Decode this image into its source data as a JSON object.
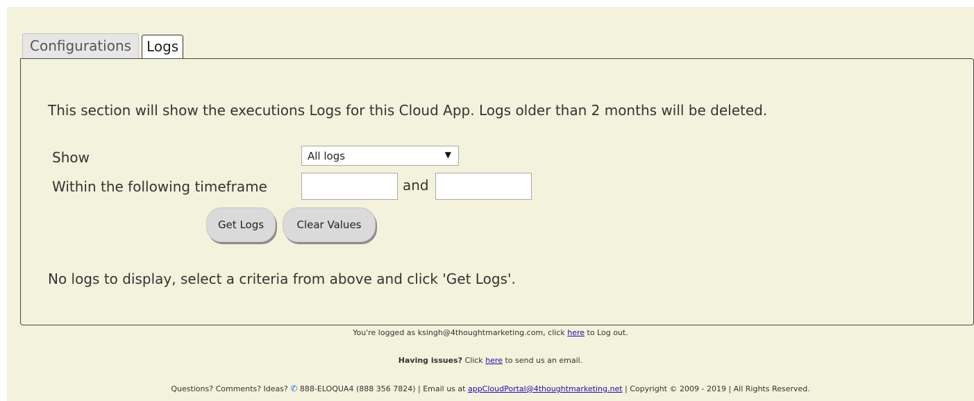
{
  "tabs": [
    {
      "label": "Configurations",
      "active": false
    },
    {
      "label": "Logs",
      "active": true
    }
  ],
  "logs": {
    "intro": "This section will show the executions Logs for this Cloud App. Logs older than 2 months will be deleted.",
    "show_label": "Show",
    "show_value": "All logs",
    "timeframe_label": "Within the following timeframe",
    "and_label": "and",
    "from_value": "",
    "to_value": "",
    "get_logs_label": "Get Logs",
    "clear_values_label": "Clear Values",
    "empty_message": "No logs to display, select a criteria from above and click 'Get Logs'."
  },
  "footer": {
    "logged_prefix": "You're logged as ksingh@4thoughtmarketing.com, click ",
    "logged_link": "here",
    "logged_suffix": " to Log out.",
    "issues_bold": "Having issues?",
    "issues_prefix": " Click ",
    "issues_link": "here",
    "issues_suffix": " to send us an email.",
    "questions_prefix": "Questions? Comments? Ideas? ",
    "phone_icon": "phone-icon",
    "phone_text": " 888-ELOQUA4 (888 356 7824) | Email us at ",
    "email_link": "appCloudPortal@4thoughtmarketing.net",
    "copyright": " | Copyright © 2009 - 2019 | All Rights Reserved."
  }
}
